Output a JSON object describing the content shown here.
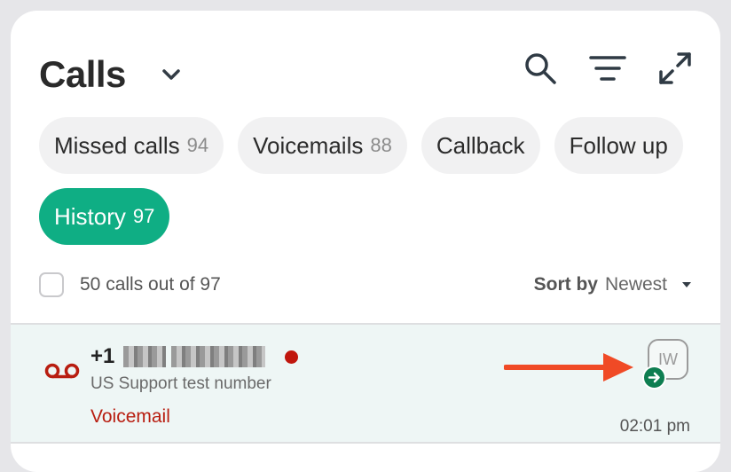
{
  "header": {
    "title": "Calls",
    "icons": [
      "chevron-down-icon",
      "search-icon",
      "filter-icon",
      "expand-icon"
    ]
  },
  "filters": [
    {
      "label": "Missed calls",
      "count": "94",
      "active": false
    },
    {
      "label": "Voicemails",
      "count": "88",
      "active": false
    },
    {
      "label": "Callback",
      "count": "",
      "active": false
    },
    {
      "label": "Follow up",
      "count": "",
      "active": false
    },
    {
      "label": "History",
      "count": "97",
      "active": true
    }
  ],
  "list_toolbar": {
    "count_text": "50 calls out of 97",
    "sort_label": "Sort by",
    "sort_value": "Newest"
  },
  "calls": [
    {
      "number_prefix": "+1",
      "line_name": "US Support test number",
      "status": "Voicemail",
      "agent_initials": "IW",
      "time": "02:01 pm"
    }
  ],
  "colors": {
    "accent": "#0fae84",
    "voicemail": "#b81d10",
    "unread_dot": "#c0160d",
    "annotation_arrow": "#f04a26",
    "badge": "#0e7e51"
  }
}
